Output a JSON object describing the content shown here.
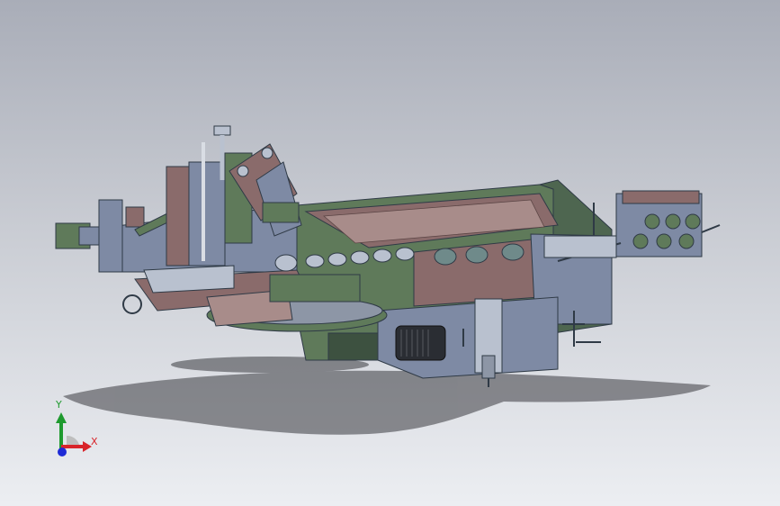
{
  "viewport": {
    "background_top": "#a9adb8",
    "background_bottom": "#eceef2"
  },
  "model": {
    "palette": {
      "frame_green": "#5f7a5a",
      "frame_dark": "#3d5140",
      "plate_brown": "#8a6b6b",
      "plate_brown_light": "#a88c8a",
      "steel_blue": "#7e8aa4",
      "steel_light": "#b9c1cf",
      "motor_black": "#2a2d33",
      "shadow": "#3a3b40"
    }
  },
  "triad": {
    "y_label": "Y",
    "x_label": "X",
    "y_color": "#1f9a2f",
    "x_color": "#d8242a",
    "z_color": "#1e2bd6",
    "icon": "coordinate-axes-icon"
  }
}
